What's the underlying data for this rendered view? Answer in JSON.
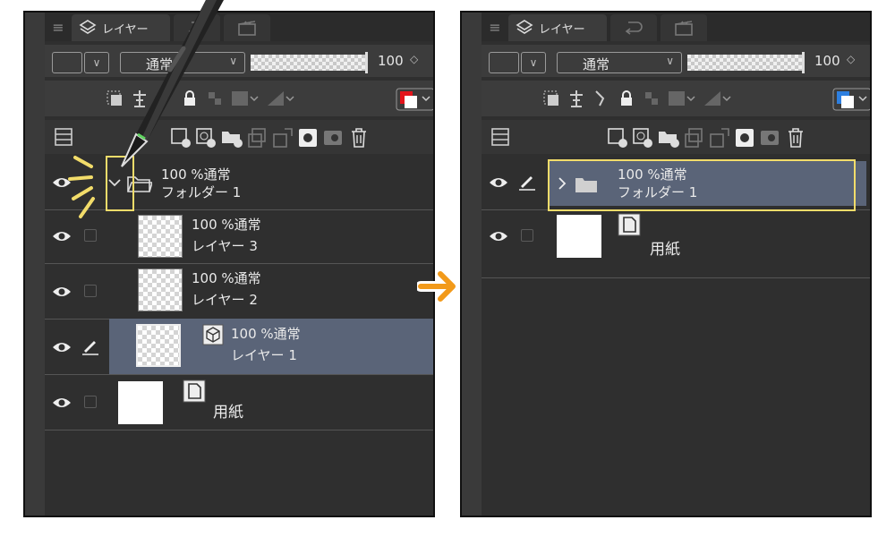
{
  "panels": {
    "left": {
      "tab_label": "レイヤー",
      "blend_mode": "通常",
      "opacity": "100",
      "layers": [
        {
          "line1": "100 %通常",
          "line2": "フォルダー 1",
          "type": "folder",
          "expanded": true
        },
        {
          "line1": "100 %通常",
          "line2": "レイヤー 3",
          "type": "raster"
        },
        {
          "line1": "100 %通常",
          "line2": "レイヤー 2",
          "type": "raster"
        },
        {
          "line1": "100 %通常",
          "line2": "レイヤー 1",
          "type": "raster",
          "selected": true
        },
        {
          "line1": "",
          "line2": "用紙",
          "type": "paper"
        }
      ]
    },
    "right": {
      "tab_label": "レイヤー",
      "blend_mode": "通常",
      "opacity": "100",
      "layers": [
        {
          "line1": "100 %通常",
          "line2": "フォルダー 1",
          "type": "folder",
          "expanded": false,
          "selected": true
        },
        {
          "line1": "",
          "line2": "用紙",
          "type": "paper"
        }
      ]
    }
  },
  "colors": {
    "panel_bg": "#2f2f2f",
    "selected_row": "#5a6478",
    "highlight": "#f2dc6a",
    "arrow": "#f29a1a",
    "left_swatch": "#e3141b",
    "right_swatch": "#2d7fe0"
  },
  "icons": [
    "layers-icon",
    "eye-icon",
    "pen-icon",
    "folder-icon",
    "paper-icon",
    "trash-icon",
    "arrow-right-icon",
    "stylus-icon"
  ]
}
